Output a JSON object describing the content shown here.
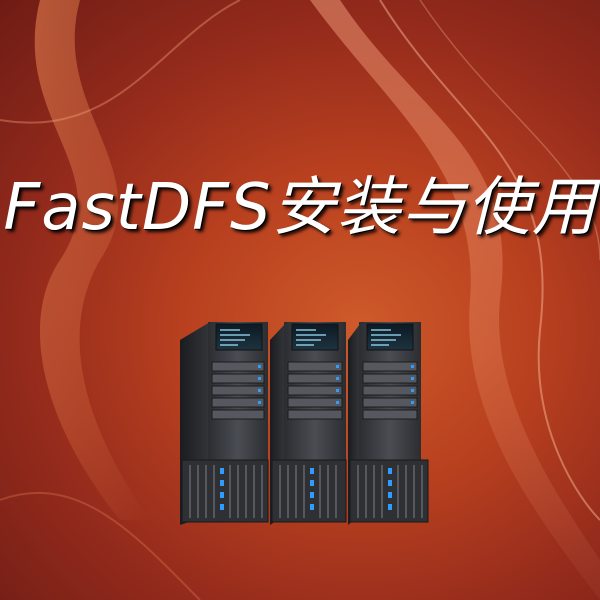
{
  "title": "FastDFS安装与使用",
  "colors": {
    "background_center": "#cf5a2a",
    "background_edge": "#6e1c15",
    "title_text": "#ffffff",
    "server_body": "#3a3d42",
    "server_led": "#2f9cff"
  },
  "illustration": {
    "server_count": 3,
    "icon": "server-rack-icon"
  }
}
